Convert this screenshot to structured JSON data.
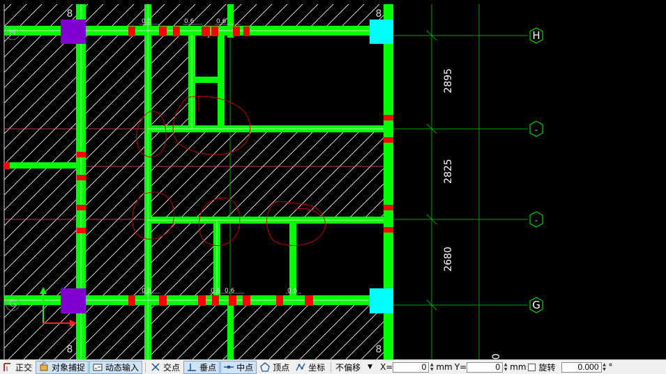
{
  "drawing": {
    "axis_labels_right": [
      "H",
      "-",
      "-",
      "G"
    ],
    "axis_labels_left": [
      "H",
      "G"
    ],
    "column_labels": {
      "top": [
        "8",
        "8"
      ],
      "bottom": [
        "8",
        "8"
      ]
    },
    "dimensions": [
      "2895",
      "2825",
      "2680"
    ],
    "partial_dimension": "0",
    "beam_tags": {
      "top": [
        "0.5",
        "0.6",
        "0.6"
      ],
      "bottom": [
        "0.6",
        "0.6",
        "0.6",
        "0.6"
      ]
    },
    "colors": {
      "background": "#000000",
      "beam": "#00ff00",
      "grid_line": "#00a000",
      "hatch": "#ffffff",
      "column_purple": "#8000d0",
      "column_cyan": "#00ffff",
      "opening_red": "#ff0000",
      "markup_red": "#c00000",
      "axis_pink": "#ff5080",
      "ucs_arrow": "#00ff00"
    }
  },
  "statusbar": {
    "ortho": {
      "label": "正交",
      "icon": "ortho-icon"
    },
    "osnap": {
      "label": "对象捕捉",
      "icon": "osnap-icon"
    },
    "dyn": {
      "label": "动态输入",
      "icon": "dyn-input-icon"
    },
    "intersection": {
      "label": "交点",
      "icon": "intersection-icon"
    },
    "perpendicular": {
      "label": "垂点",
      "icon": "perpendicular-icon"
    },
    "midpoint": {
      "label": "中点",
      "icon": "midpoint-icon"
    },
    "vertex": {
      "label": "顶点",
      "icon": "vertex-icon"
    },
    "coordinate": {
      "label": "坐标",
      "icon": "coordinate-icon"
    },
    "offset_mode": "不偏移",
    "x_label": "X=",
    "x_value": "0",
    "x_unit": "mm",
    "y_label": "Y=",
    "y_value": "0",
    "y_unit": "mm",
    "rotate_label": "旋转",
    "rotate_value": "0.000",
    "degree": "°"
  }
}
